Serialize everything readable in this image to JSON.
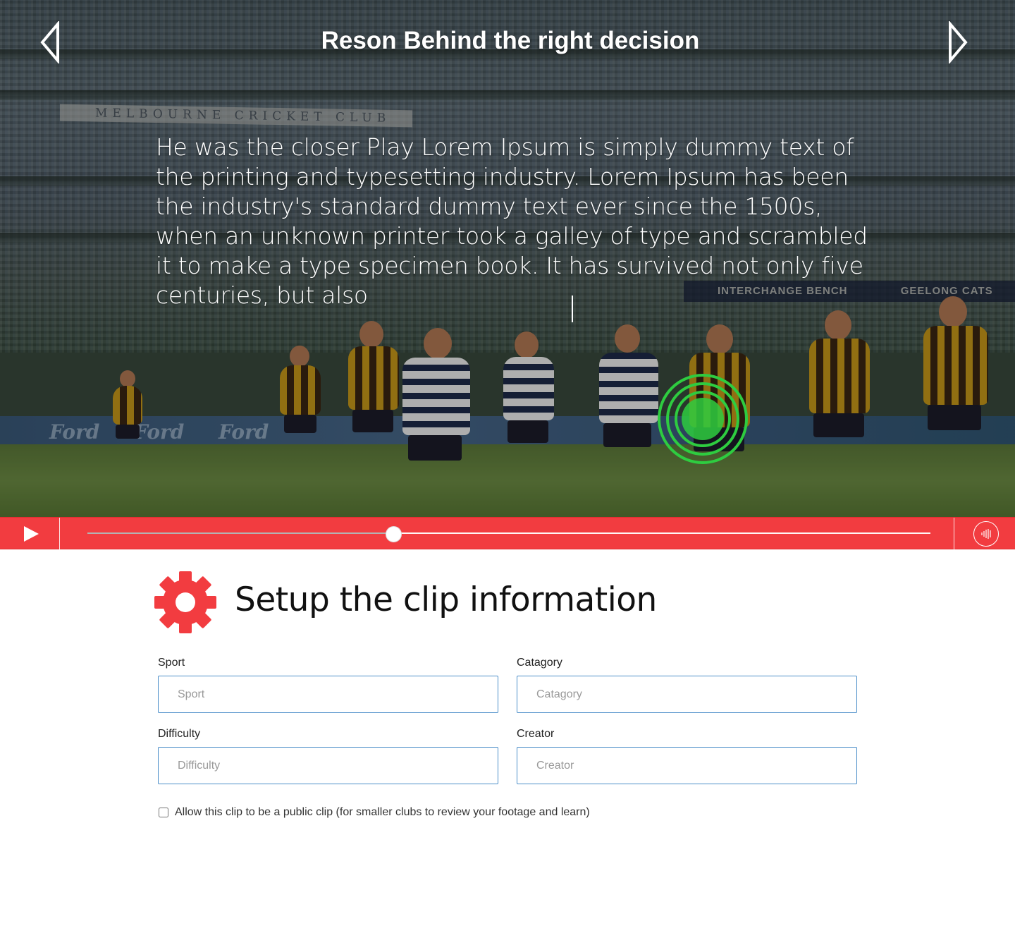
{
  "video": {
    "title": "Reson Behind the right decision",
    "annotation_text": "He was the closer Play Lorem Ipsum is simply dummy text of the printing and typesetting industry. Lorem Ipsum has been the industry's standard dummy text ever since the 1500s, when an unknown printer took a galley of type and scrambled it to make a type specimen book. It has survived not only five centuries, but also",
    "stadium_banner": "MELBOURNE CRICKET CLUB",
    "bench_banner": "INTERCHANGE BENCH",
    "team_banner": "GEELONG CATS",
    "ad_board": "Ford",
    "prev_icon": "chevron-left-outline-icon",
    "next_icon": "chevron-right-outline-icon",
    "hotspot_color": "#2ecc40"
  },
  "controls": {
    "play_icon": "play-icon",
    "audio_icon": "audio-waveform-icon",
    "progress_fraction": 0.363,
    "accent_color": "#f23c40"
  },
  "setup": {
    "icon": "gear-icon",
    "title": "Setup the clip information",
    "fields": {
      "sport": {
        "label": "Sport",
        "placeholder": "Sport",
        "value": ""
      },
      "category": {
        "label": "Catagory",
        "placeholder": "Catagory",
        "value": ""
      },
      "difficulty": {
        "label": "Difficulty",
        "placeholder": "Difficulty",
        "value": ""
      },
      "creator": {
        "label": "Creator",
        "placeholder": "Creator",
        "value": ""
      }
    },
    "public_checkbox": {
      "label": "Allow this clip to be a public clip (for smaller clubs to review your footage and learn)",
      "checked": false
    }
  }
}
